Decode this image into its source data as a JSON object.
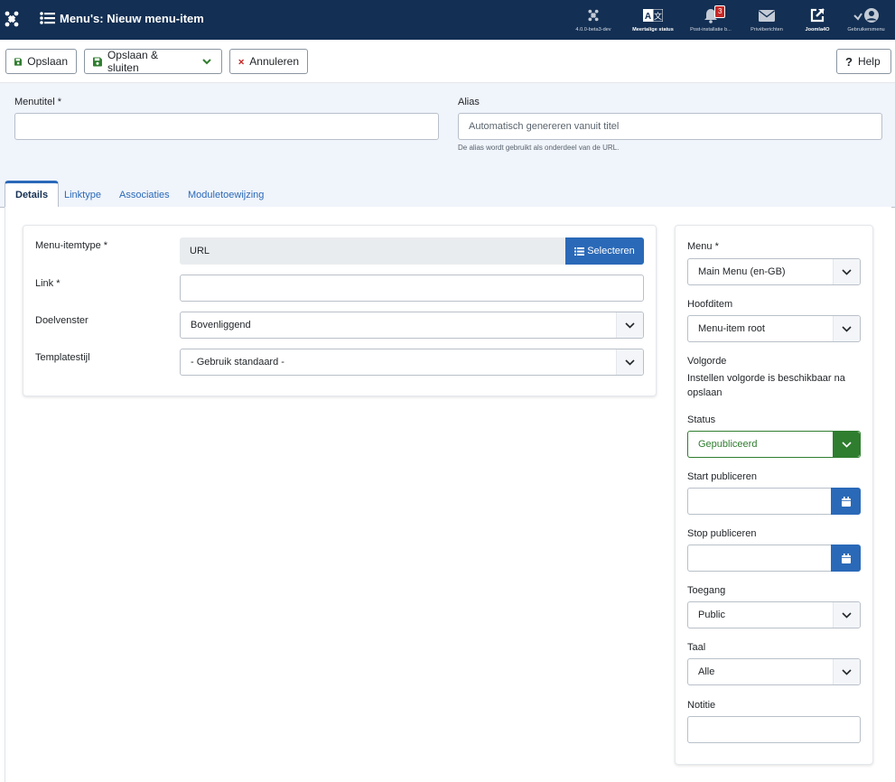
{
  "header": {
    "title": "Menu's: Nieuw menu-item",
    "items": [
      {
        "label": "4.0.0-beta3-dev",
        "icon": "joomla-icon"
      },
      {
        "label": "Meertalige status",
        "icon": "language-icon"
      },
      {
        "label": "Post-installatie b...",
        "icon": "bell-icon",
        "badge": "3"
      },
      {
        "label": "Privéberichten",
        "icon": "envelope-icon"
      },
      {
        "label": "Joomla4O",
        "icon": "external-link-icon"
      },
      {
        "label": "Gebruikersmenu",
        "icon": "user-icon"
      }
    ]
  },
  "toolbar": {
    "save": "Opslaan",
    "save_close": "Opslaan & sluiten",
    "cancel": "Annuleren",
    "help": "Help"
  },
  "title_area": {
    "title_label": "Menutitel *",
    "title_value": "",
    "alias_label": "Alias",
    "alias_placeholder": "Automatisch genereren vanuit titel",
    "alias_hint": "De alias wordt gebruikt als onderdeel van de URL."
  },
  "tabs": [
    "Details",
    "Linktype",
    "Associaties",
    "Moduletoewijzing"
  ],
  "details": {
    "type_label": "Menu-itemtype *",
    "type_value": "URL",
    "select_button": "Selecteren",
    "link_label": "Link *",
    "link_value": "",
    "target_label": "Doelvenster",
    "target_value": "Bovenliggend",
    "template_label": "Templatestijl",
    "template_value": "- Gebruik standaard -"
  },
  "sidebar": {
    "menu_label": "Menu *",
    "menu_value": "Main Menu (en-GB)",
    "parent_label": "Hoofditem",
    "parent_value": "Menu-item root",
    "order_label": "Volgorde",
    "order_text": "Instellen volgorde is beschikbaar na opslaan",
    "status_label": "Status",
    "status_value": "Gepubliceerd",
    "publish_up_label": "Start publiceren",
    "publish_down_label": "Stop publiceren",
    "access_label": "Toegang",
    "access_value": "Public",
    "language_label": "Taal",
    "language_value": "Alle",
    "note_label": "Notitie"
  },
  "colors": {
    "header_bg": "#132f53",
    "accent": "#2a69b8",
    "published": "#2f7d2f",
    "cancel": "#c52827"
  }
}
